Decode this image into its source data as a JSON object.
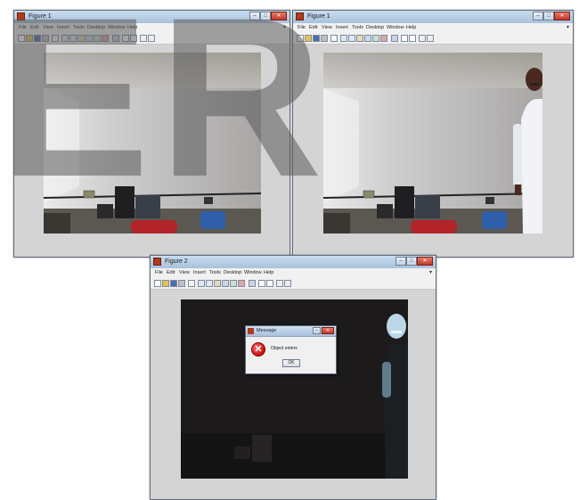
{
  "windows": [
    {
      "title": "Figure 1",
      "menu": [
        "File",
        "Edit",
        "View",
        "Insert",
        "Tools",
        "Desktop",
        "Window",
        "Help"
      ],
      "frame": "empty-room"
    },
    {
      "title": "Figure 1",
      "menu": [
        "File",
        "Edit",
        "View",
        "Insert",
        "Tools",
        "Desktop",
        "Window",
        "Help"
      ],
      "frame": "person-entering"
    },
    {
      "title": "Figure 2",
      "menu": [
        "File",
        "Edit",
        "View",
        "Insert",
        "Tools",
        "Desktop",
        "Window",
        "Help"
      ],
      "frame": "difference-image"
    }
  ],
  "dialog": {
    "title": "Message",
    "message": "Object enters",
    "ok_label": "OK",
    "icon": "error-icon"
  },
  "watermark": [
    "E",
    "R"
  ],
  "titlebar_icons": [
    "minimize-icon",
    "maximize-icon",
    "close-icon"
  ],
  "colors": {
    "window_bg": "#d4d4d4",
    "titlebar": "#b9cfe6",
    "close": "#c3382a",
    "chair_red": "#b2242a",
    "chair_blue": "#2f5fa8"
  }
}
